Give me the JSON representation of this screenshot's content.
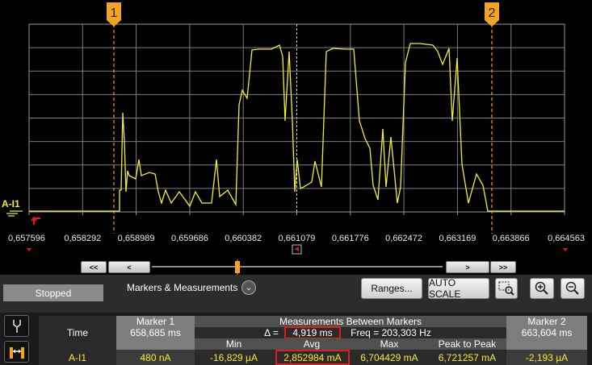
{
  "channel": "A-I1",
  "markers": [
    {
      "label": "1"
    },
    {
      "label": "2"
    }
  ],
  "time_axis": {
    "ticks": [
      "0,657596",
      "0,658292",
      "0,658989",
      "0,659686",
      "0,660382",
      "0,661079",
      "0,661776",
      "0,662472",
      "0,663169",
      "0,663866",
      "0,664563"
    ]
  },
  "status": {
    "state": "Stopped",
    "panel_label": "Markers & Measurements"
  },
  "toolbar": {
    "ranges_label": "Ranges...",
    "autoscale_label": "AUTO SCALE"
  },
  "nav": {
    "first": "<<",
    "prev": "<",
    "next": ">",
    "last": ">>"
  },
  "table": {
    "headers": {
      "marker1": "Marker 1",
      "between": "Measurements Between Markers",
      "marker2": "Marker 2",
      "min": "Min",
      "avg": "Avg",
      "max": "Max",
      "p2p": "Peak to Peak"
    },
    "time_row": {
      "label": "Time",
      "marker1": "658,685 ms",
      "delta_prefix": "Δ =",
      "delta": "4,919 ms",
      "freq": "Freq = 203,303 Hz",
      "marker2": "663,604 ms"
    },
    "value_row": {
      "label": "A-I1",
      "marker1": "480 nA",
      "min": "-16,829 µA",
      "avg": "2,852984 mA",
      "max": "6,704429 mA",
      "p2p": "6,721257 mA",
      "marker2": "-2,193 µA"
    }
  },
  "colors": {
    "trace": "#f3ef2f",
    "marker": "#f2a321",
    "grid": "#8c8c8c",
    "highlight": "#e21b1b",
    "panel": "#2c2c2c"
  }
}
